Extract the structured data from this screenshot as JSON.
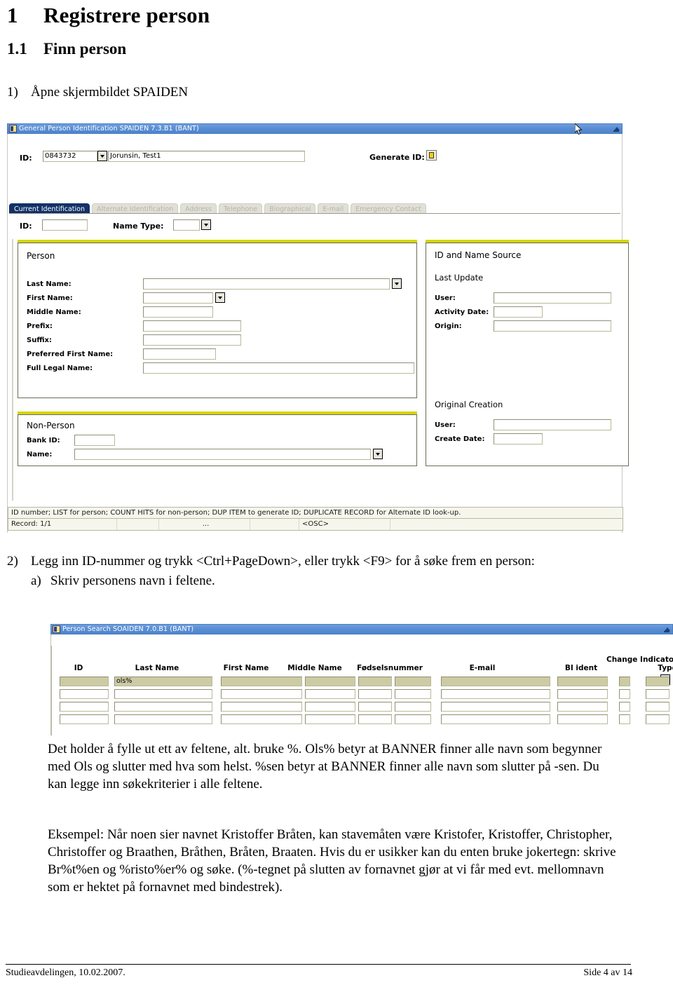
{
  "document": {
    "heading1": {
      "number": "1",
      "text": "Registrere person"
    },
    "heading2": {
      "number": "1.1",
      "text": "Finn person"
    },
    "step1": {
      "number": "1)",
      "text": "Åpne skjermbildet SPAIDEN"
    },
    "step2": {
      "number": "2)",
      "text": "Legg inn ID-nummer og trykk <Ctrl+PageDown>, eller trykk <F9> for å søke frem en person:",
      "substep_letter": "a)",
      "substep_text": "Skriv personens navn i feltene."
    },
    "paragraph_wildcards": "Det holder å fylle ut ett av feltene, alt. bruke %. Ols% betyr at BANNER finner alle navn som begynner med Ols og slutter med hva som helst. %sen betyr at BANNER finner alle navn som slutter på -sen. Du kan legge inn søkekriterier i alle feltene.",
    "paragraph_example": "Eksempel: Når noen sier navnet Kristoffer Bråten, kan stavemåten være Kristofer, Kristoffer, Christopher, Christoffer og Braathen, Bråthen, Bråten, Braaten. Hvis du er usikker kan du enten bruke jokertegn: skrive Br%t%en og %risto%er% og søke. (%-tegnet på slutten av fornavnet gjør at vi får med evt. mellomnavn som er hektet på fornavnet med bindestrek).",
    "footer": {
      "left": "Studieavdelingen, 10.02.2007.",
      "right": "Side 4 av 14"
    }
  },
  "spaiden": {
    "title": "General Person Identification  SPAIDEN  7.3.B1  (BANT)",
    "key_block": {
      "id_label": "ID:",
      "id_value": "0843732",
      "name_value": "Jorunsin, Test1",
      "generate_id_label": "Generate ID:"
    },
    "tabs": [
      {
        "label": "Current Identification",
        "active": true
      },
      {
        "label": "Alternate Identification",
        "active": false
      },
      {
        "label": "Address",
        "active": false
      },
      {
        "label": "Telephone",
        "active": false
      },
      {
        "label": "Biographical",
        "active": false
      },
      {
        "label": "E-mail",
        "active": false
      },
      {
        "label": "Emergency Contact",
        "active": false
      }
    ],
    "tab_fields": {
      "id_label": "ID:",
      "id_value": "",
      "name_type_label": "Name Type:",
      "name_type_value": ""
    },
    "person_group": {
      "title": "Person",
      "fields": [
        {
          "label": "Last Name:",
          "value": ""
        },
        {
          "label": "First Name:",
          "value": ""
        },
        {
          "label": "Middle Name:",
          "value": ""
        },
        {
          "label": "Prefix:",
          "value": ""
        },
        {
          "label": "Suffix:",
          "value": ""
        },
        {
          "label": "Preferred First Name:",
          "value": ""
        },
        {
          "label": "Full Legal Name:",
          "value": ""
        }
      ]
    },
    "nonperson_group": {
      "title": "Non-Person",
      "fields": [
        {
          "label": "Bank ID:",
          "value": ""
        },
        {
          "label": "Name:",
          "value": ""
        }
      ]
    },
    "source_group": {
      "title": "ID and Name Source",
      "last_update_title": "Last Update",
      "last_update_fields": [
        {
          "label": "User:",
          "value": ""
        },
        {
          "label": "Activity Date:",
          "value": ""
        },
        {
          "label": "Origin:",
          "value": ""
        }
      ],
      "original_creation_title": "Original Creation",
      "original_creation_fields": [
        {
          "label": "User:",
          "value": ""
        },
        {
          "label": "Create Date:",
          "value": ""
        }
      ]
    },
    "status": {
      "message": "ID number; LIST for person; COUNT HITS for non-person; DUP ITEM to generate ID; DUPLICATE RECORD for Alternate ID look-up.",
      "record": "Record: 1/1",
      "cell2": "",
      "cell3": "...",
      "cell4": "",
      "cell5": "<OSC>",
      "cell6": ""
    }
  },
  "soaiden": {
    "title": "Person Search  SOAIDEN  7.0.B1  (BANT)",
    "columns": [
      "ID",
      "Last Name",
      "First Name",
      "Middle Name",
      "Fødselsnummer",
      "E-mail",
      "BI ident",
      "Change Indicator",
      "Type"
    ],
    "rows": [
      {
        "id": "",
        "last_name": "ols%",
        "first_name": "",
        "middle_name": "",
        "fodselsnummer": "",
        "email": "",
        "bi_ident": "",
        "change_indicator": "",
        "type": "",
        "selected": true
      },
      {
        "id": "",
        "last_name": "",
        "first_name": "",
        "middle_name": "",
        "fodselsnummer": "",
        "email": "",
        "bi_ident": "",
        "change_indicator": "",
        "type": "",
        "selected": false
      },
      {
        "id": "",
        "last_name": "",
        "first_name": "",
        "middle_name": "",
        "fodselsnummer": "",
        "email": "",
        "bi_ident": "",
        "change_indicator": "",
        "type": "",
        "selected": false
      },
      {
        "id": "",
        "last_name": "",
        "first_name": "",
        "middle_name": "",
        "fodselsnummer": "",
        "email": "",
        "bi_ident": "",
        "change_indicator": "",
        "type": "",
        "selected": false
      }
    ]
  },
  "colors": {
    "titlebar_blue": "#5b8fd4",
    "active_tab_navy": "#123167",
    "group_accent_yellow": "#d5d505",
    "field_border": "#b9b99a",
    "selected_row": "#cdcba4",
    "status_bg": "#f6f6ec"
  }
}
